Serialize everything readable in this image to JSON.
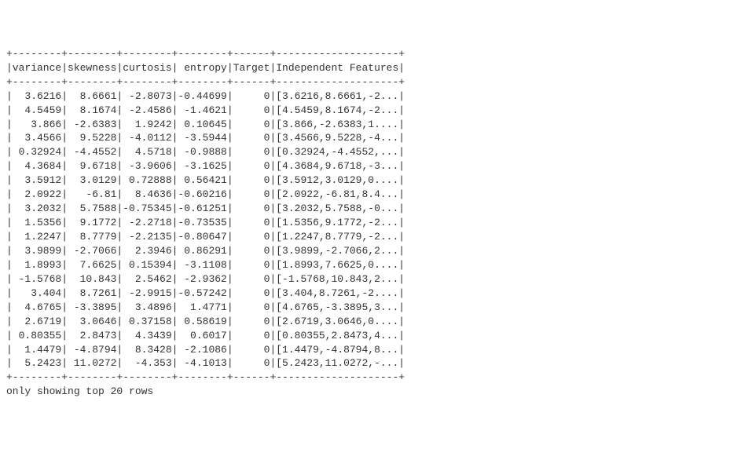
{
  "border": {
    "corner": "+",
    "hfill": "-",
    "vbar": "|"
  },
  "col_widths": {
    "variance": 8,
    "skewness": 8,
    "curtosis": 8,
    "entropy": 8,
    "Target": 6,
    "Independent Features": 20
  },
  "headers": [
    "variance",
    "skewness",
    "curtosis",
    " entropy",
    "Target",
    "Independent Features"
  ],
  "header_align": [
    "left",
    "left",
    "left",
    "left",
    "left",
    "left"
  ],
  "rows": [
    {
      "variance": "  3.6216",
      "skewness": "  8.6661",
      "curtosis": " -2.8073",
      "entropy": "-0.44699",
      "Target": "     0",
      "Independent Features": "[3.6216,8.6661,-2..."
    },
    {
      "variance": "  4.5459",
      "skewness": "  8.1674",
      "curtosis": " -2.4586",
      "entropy": " -1.4621",
      "Target": "     0",
      "Independent Features": "[4.5459,8.1674,-2..."
    },
    {
      "variance": "   3.866",
      "skewness": " -2.6383",
      "curtosis": "  1.9242",
      "entropy": " 0.10645",
      "Target": "     0",
      "Independent Features": "[3.866,-2.6383,1...."
    },
    {
      "variance": "  3.4566",
      "skewness": "  9.5228",
      "curtosis": " -4.0112",
      "entropy": " -3.5944",
      "Target": "     0",
      "Independent Features": "[3.4566,9.5228,-4..."
    },
    {
      "variance": " 0.32924",
      "skewness": " -4.4552",
      "curtosis": "  4.5718",
      "entropy": " -0.9888",
      "Target": "     0",
      "Independent Features": "[0.32924,-4.4552,..."
    },
    {
      "variance": "  4.3684",
      "skewness": "  9.6718",
      "curtosis": " -3.9606",
      "entropy": " -3.1625",
      "Target": "     0",
      "Independent Features": "[4.3684,9.6718,-3..."
    },
    {
      "variance": "  3.5912",
      "skewness": "  3.0129",
      "curtosis": " 0.72888",
      "entropy": " 0.56421",
      "Target": "     0",
      "Independent Features": "[3.5912,3.0129,0...."
    },
    {
      "variance": "  2.0922",
      "skewness": "   -6.81",
      "curtosis": "  8.4636",
      "entropy": "-0.60216",
      "Target": "     0",
      "Independent Features": "[2.0922,-6.81,8.4..."
    },
    {
      "variance": "  3.2032",
      "skewness": "  5.7588",
      "curtosis": "-0.75345",
      "entropy": "-0.61251",
      "Target": "     0",
      "Independent Features": "[3.2032,5.7588,-0..."
    },
    {
      "variance": "  1.5356",
      "skewness": "  9.1772",
      "curtosis": " -2.2718",
      "entropy": "-0.73535",
      "Target": "     0",
      "Independent Features": "[1.5356,9.1772,-2..."
    },
    {
      "variance": "  1.2247",
      "skewness": "  8.7779",
      "curtosis": " -2.2135",
      "entropy": "-0.80647",
      "Target": "     0",
      "Independent Features": "[1.2247,8.7779,-2..."
    },
    {
      "variance": "  3.9899",
      "skewness": " -2.7066",
      "curtosis": "  2.3946",
      "entropy": " 0.86291",
      "Target": "     0",
      "Independent Features": "[3.9899,-2.7066,2..."
    },
    {
      "variance": "  1.8993",
      "skewness": "  7.6625",
      "curtosis": " 0.15394",
      "entropy": " -3.1108",
      "Target": "     0",
      "Independent Features": "[1.8993,7.6625,0...."
    },
    {
      "variance": " -1.5768",
      "skewness": "  10.843",
      "curtosis": "  2.5462",
      "entropy": " -2.9362",
      "Target": "     0",
      "Independent Features": "[-1.5768,10.843,2..."
    },
    {
      "variance": "   3.404",
      "skewness": "  8.7261",
      "curtosis": " -2.9915",
      "entropy": "-0.57242",
      "Target": "     0",
      "Independent Features": "[3.404,8.7261,-2...."
    },
    {
      "variance": "  4.6765",
      "skewness": " -3.3895",
      "curtosis": "  3.4896",
      "entropy": "  1.4771",
      "Target": "     0",
      "Independent Features": "[4.6765,-3.3895,3..."
    },
    {
      "variance": "  2.6719",
      "skewness": "  3.0646",
      "curtosis": " 0.37158",
      "entropy": " 0.58619",
      "Target": "     0",
      "Independent Features": "[2.6719,3.0646,0...."
    },
    {
      "variance": " 0.80355",
      "skewness": "  2.8473",
      "curtosis": "  4.3439",
      "entropy": "  0.6017",
      "Target": "     0",
      "Independent Features": "[0.80355,2.8473,4..."
    },
    {
      "variance": "  1.4479",
      "skewness": " -4.8794",
      "curtosis": "  8.3428",
      "entropy": " -2.1086",
      "Target": "     0",
      "Independent Features": "[1.4479,-4.8794,8..."
    },
    {
      "variance": "  5.2423",
      "skewness": " 11.0272",
      "curtosis": "  -4.353",
      "entropy": " -4.1013",
      "Target": "     0",
      "Independent Features": "[5.2423,11.0272,-..."
    }
  ],
  "footer": "only showing top 20 rows",
  "chart_data": {
    "type": "table",
    "columns": [
      "variance",
      "skewness",
      "curtosis",
      "entropy",
      "Target",
      "Independent Features"
    ],
    "rows": [
      [
        3.6216,
        8.6661,
        -2.8073,
        -0.44699,
        0,
        "[3.6216,8.6661,-2...]"
      ],
      [
        4.5459,
        8.1674,
        -2.4586,
        -1.4621,
        0,
        "[4.5459,8.1674,-2...]"
      ],
      [
        3.866,
        -2.6383,
        1.9242,
        0.10645,
        0,
        "[3.866,-2.6383,1....]"
      ],
      [
        3.4566,
        9.5228,
        -4.0112,
        -3.5944,
        0,
        "[3.4566,9.5228,-4...]"
      ],
      [
        0.32924,
        -4.4552,
        4.5718,
        -0.9888,
        0,
        "[0.32924,-4.4552,...]"
      ],
      [
        4.3684,
        9.6718,
        -3.9606,
        -3.1625,
        0,
        "[4.3684,9.6718,-3...]"
      ],
      [
        3.5912,
        3.0129,
        0.72888,
        0.56421,
        0,
        "[3.5912,3.0129,0....]"
      ],
      [
        2.0922,
        -6.81,
        8.4636,
        -0.60216,
        0,
        "[2.0922,-6.81,8.4...]"
      ],
      [
        3.2032,
        5.7588,
        -0.75345,
        -0.61251,
        0,
        "[3.2032,5.7588,-0...]"
      ],
      [
        1.5356,
        9.1772,
        -2.2718,
        -0.73535,
        0,
        "[1.5356,9.1772,-2...]"
      ],
      [
        1.2247,
        8.7779,
        -2.2135,
        -0.80647,
        0,
        "[1.2247,8.7779,-2...]"
      ],
      [
        3.9899,
        -2.7066,
        2.3946,
        0.86291,
        0,
        "[3.9899,-2.7066,2...]"
      ],
      [
        1.8993,
        7.6625,
        0.15394,
        -3.1108,
        0,
        "[1.8993,7.6625,0....]"
      ],
      [
        -1.5768,
        10.843,
        2.5462,
        -2.9362,
        0,
        "[-1.5768,10.843,2...]"
      ],
      [
        3.404,
        8.7261,
        -2.9915,
        -0.57242,
        0,
        "[3.404,8.7261,-2....]"
      ],
      [
        4.6765,
        -3.3895,
        3.4896,
        1.4771,
        0,
        "[4.6765,-3.3895,3...]"
      ],
      [
        2.6719,
        3.0646,
        0.37158,
        0.58619,
        0,
        "[2.6719,3.0646,0....]"
      ],
      [
        0.80355,
        2.8473,
        4.3439,
        0.6017,
        0,
        "[0.80355,2.8473,4...]"
      ],
      [
        1.4479,
        -4.8794,
        8.3428,
        -2.1086,
        0,
        "[1.4479,-4.8794,8...]"
      ],
      [
        5.2423,
        11.0272,
        -4.353,
        -4.1013,
        0,
        "[5.2423,11.0272,-...]"
      ]
    ],
    "note": "only showing top 20 rows"
  }
}
